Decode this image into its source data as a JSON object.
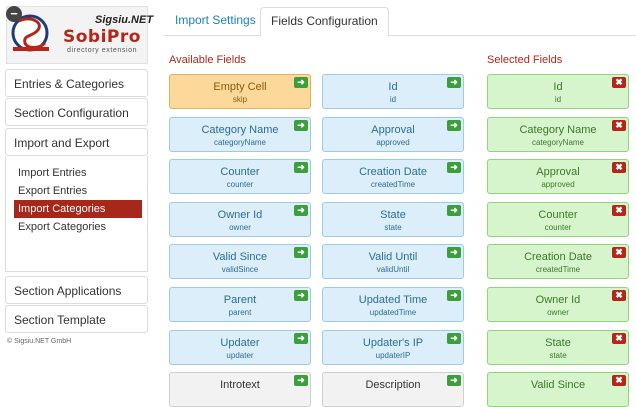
{
  "logo": {
    "brand": "Sigsiu.NET",
    "product": "SobiPro",
    "tagline": "directory extension",
    "toggle": "−"
  },
  "sidebar": {
    "panels": [
      "Entries & Categories",
      "Section Configuration",
      "Import and Export",
      "Section Applications",
      "Section Template"
    ],
    "sub_items": [
      "Import Entries",
      "Export Entries",
      "Import Categories",
      "Export Categories"
    ],
    "active_sub": "Import Categories",
    "copyright": "© Sigsiu.NET GmbH"
  },
  "tabs": [
    "Import Settings",
    "Fields Configuration"
  ],
  "active_tab": "Fields Configuration",
  "available_title": "Available Fields",
  "selected_title": "Selected Fields",
  "add_icon": "➜",
  "remove_icon": "✖",
  "available_col1": [
    {
      "name": "Empty Cell",
      "key": "skip"
    },
    {
      "name": "Category Name",
      "key": "categoryName"
    },
    {
      "name": "Counter",
      "key": "counter"
    },
    {
      "name": "Owner Id",
      "key": "owner"
    },
    {
      "name": "Valid Since",
      "key": "validSince"
    },
    {
      "name": "Parent",
      "key": "parent"
    },
    {
      "name": "Updater",
      "key": "updater"
    },
    {
      "name": "Introtext",
      "key": ""
    }
  ],
  "available_col2": [
    {
      "name": "Id",
      "key": "id"
    },
    {
      "name": "Approval",
      "key": "approved"
    },
    {
      "name": "Creation Date",
      "key": "createdTime"
    },
    {
      "name": "State",
      "key": "state"
    },
    {
      "name": "Valid Until",
      "key": "validUntil"
    },
    {
      "name": "Updated Time",
      "key": "updatedTime"
    },
    {
      "name": "Updater's IP",
      "key": "updaterIP"
    },
    {
      "name": "Description",
      "key": ""
    }
  ],
  "selected": [
    {
      "name": "Id",
      "key": "id"
    },
    {
      "name": "Category Name",
      "key": "categoryName"
    },
    {
      "name": "Approval",
      "key": "approved"
    },
    {
      "name": "Counter",
      "key": "counter"
    },
    {
      "name": "Creation Date",
      "key": "createdTime"
    },
    {
      "name": "Owner Id",
      "key": "owner"
    },
    {
      "name": "State",
      "key": "state"
    },
    {
      "name": "Valid Since",
      "key": ""
    }
  ],
  "colors": {
    "accent": "#b52619",
    "link": "#1a82c0",
    "available_bg": "#dbeefa",
    "selected_bg": "#d7f5cd",
    "empty_bg": "#fcd89a"
  }
}
